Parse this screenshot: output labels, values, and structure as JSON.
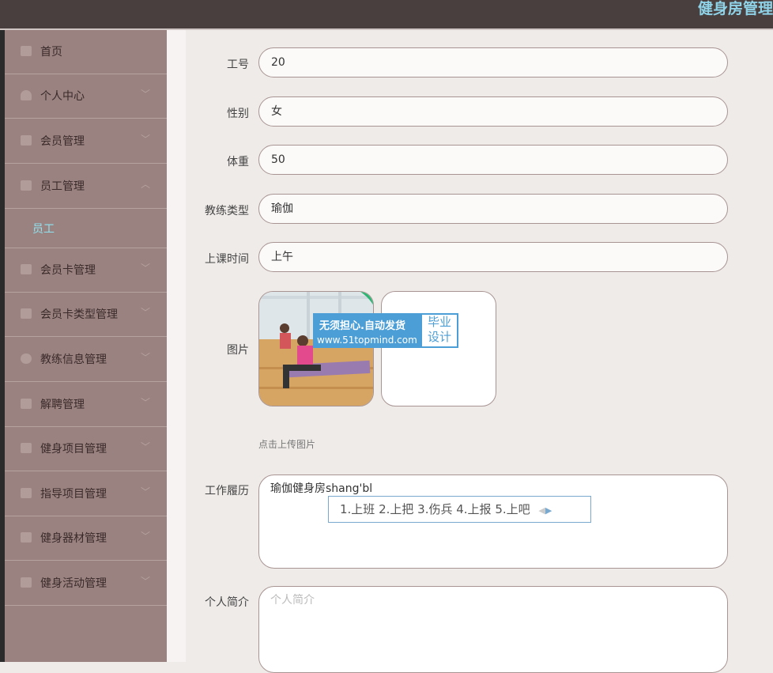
{
  "header": {
    "title": "健身房管理"
  },
  "sidebar": {
    "items": [
      {
        "label": "首页",
        "icon": "home-icon",
        "expandable": false
      },
      {
        "label": "个人中心",
        "icon": "user-icon",
        "expandable": true
      },
      {
        "label": "会员管理",
        "icon": "flag-icon",
        "expandable": true
      },
      {
        "label": "员工管理",
        "icon": "monitor-icon",
        "expandable": true,
        "expanded": true
      },
      {
        "label": "会员卡管理",
        "icon": "card-icon",
        "expandable": true
      },
      {
        "label": "会员卡类型管理",
        "icon": "list-icon",
        "expandable": true
      },
      {
        "label": "教练信息管理",
        "icon": "info-icon",
        "expandable": true
      },
      {
        "label": "解聘管理",
        "icon": "send-icon",
        "expandable": true
      },
      {
        "label": "健身项目管理",
        "icon": "doc-icon",
        "expandable": true
      },
      {
        "label": "指导项目管理",
        "icon": "clipboard-icon",
        "expandable": true
      },
      {
        "label": "健身器材管理",
        "icon": "tool-icon",
        "expandable": true
      },
      {
        "label": "健身活动管理",
        "icon": "calendar-icon",
        "expandable": true
      }
    ],
    "subitem": {
      "label": "员工"
    },
    "accent_color": "#8fe3f0"
  },
  "form": {
    "fields": [
      {
        "label": "工号",
        "value": "20"
      },
      {
        "label": "性别",
        "value": "女"
      },
      {
        "label": "体重",
        "value": "50"
      },
      {
        "label": "教练类型",
        "value": "瑜伽"
      },
      {
        "label": "上课时间",
        "value": "上午"
      }
    ],
    "image": {
      "label": "图片",
      "hint": "点击上传图片",
      "watermark_line1": "无须担心.自动发货",
      "watermark_line2": "www.51topmind.com",
      "watermark_badge": "毕业设计"
    },
    "work_history": {
      "label": "工作履历",
      "value": "瑜伽健身房shang'bl"
    },
    "ime": {
      "candidates": "1.上班  2.上把  3.伤兵  4.上报  5.上吧"
    },
    "intro": {
      "label": "个人简介",
      "placeholder": "个人简介"
    }
  }
}
